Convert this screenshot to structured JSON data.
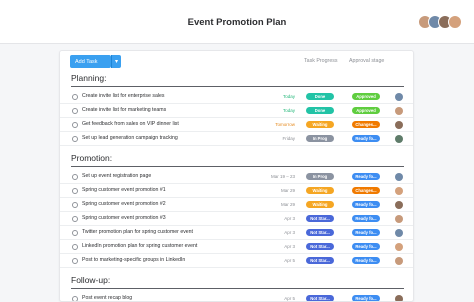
{
  "header": {
    "title": "Event Promotion Plan",
    "avatars": [
      "#c79a7b",
      "#6f89a8",
      "#8a6d5a",
      "#d4a17c"
    ]
  },
  "toolbar": {
    "add_task_label": "Add Task",
    "caret_icon": "chevron-down-icon",
    "col_progress": "Task Progress",
    "col_approval": "Approval stage"
  },
  "colors": {
    "accent": "#3aa0f0",
    "done": "#22c3a6",
    "approved": "#5fcd3f",
    "waiting": "#f5a623",
    "changes": "#f07a00",
    "in_prog": "#8b93a1",
    "ready": "#3d8df2",
    "not_started": "#4a68d9"
  },
  "sections": [
    {
      "label": "Planning:",
      "tasks": [
        {
          "name": "Create invite list for enterprise sales",
          "due": "Today",
          "due_color": "green",
          "progress": "Done",
          "progress_color": "#22c3a6",
          "approval": "Approved",
          "approval_color": "#5fcd3f",
          "avatar": "#6f89a8"
        },
        {
          "name": "Create invite list for marketing teams",
          "due": "Today",
          "due_color": "green",
          "progress": "Done",
          "progress_color": "#22c3a6",
          "approval": "Approved",
          "approval_color": "#5fcd3f",
          "avatar": "#c79a7b"
        },
        {
          "name": "Get feedback from sales on VIP dinner list",
          "due": "Tomorrow",
          "due_color": "orange",
          "progress": "Waiting",
          "progress_color": "#f5a623",
          "approval": "Changes...",
          "approval_color": "#f07a00",
          "avatar": "#8a6d5a"
        },
        {
          "name": "Set up lead generation campaign tracking",
          "due": "Friday",
          "due_color": "",
          "progress": "In Prog",
          "progress_color": "#8b93a1",
          "approval": "Ready fo...",
          "approval_color": "#3d8df2",
          "avatar": "#5f7c6a"
        }
      ]
    },
    {
      "label": "Promotion:",
      "tasks": [
        {
          "name": "Set up event registration page",
          "due": "Mar 19 – 23",
          "due_color": "",
          "progress": "In Prog",
          "progress_color": "#8b93a1",
          "approval": "Ready fo...",
          "approval_color": "#3d8df2",
          "avatar": "#6f89a8"
        },
        {
          "name": "Spring customer event promotion #1",
          "due": "Mar 29",
          "due_color": "",
          "progress": "Waiting",
          "progress_color": "#f5a623",
          "approval": "Changes...",
          "approval_color": "#f07a00",
          "avatar": "#d4a17c"
        },
        {
          "name": "Spring customer event promotion #2",
          "due": "Mar 29",
          "due_color": "",
          "progress": "Waiting",
          "progress_color": "#f5a623",
          "approval": "Ready fo...",
          "approval_color": "#3d8df2",
          "avatar": "#8a6d5a"
        },
        {
          "name": "Spring customer event promotion #3",
          "due": "Apr 3",
          "due_color": "",
          "progress": "Not Star...",
          "progress_color": "#4a68d9",
          "approval": "Ready fo...",
          "approval_color": "#3d8df2",
          "avatar": "#c79a7b"
        },
        {
          "name": "Twitter promotion plan for spring customer event",
          "due": "Apr 3",
          "due_color": "",
          "progress": "Not Star...",
          "progress_color": "#4a68d9",
          "approval": "Ready fo...",
          "approval_color": "#3d8df2",
          "avatar": "#6f89a8"
        },
        {
          "name": "LinkedIn promotion plan for spring customer event",
          "due": "Apr 3",
          "due_color": "",
          "progress": "Not Star...",
          "progress_color": "#4a68d9",
          "approval": "Ready fo...",
          "approval_color": "#3d8df2",
          "avatar": "#d4a17c"
        },
        {
          "name": "Post to marketing-specific groups in LinkedIn",
          "due": "Apr 5",
          "due_color": "",
          "progress": "Not Star...",
          "progress_color": "#4a68d9",
          "approval": "Ready fo...",
          "approval_color": "#3d8df2",
          "avatar": "#c79a7b"
        }
      ]
    },
    {
      "label": "Follow-up:",
      "tasks": [
        {
          "name": "Post event recap blog",
          "due": "Apr 5",
          "due_color": "",
          "progress": "Not Star...",
          "progress_color": "#4a68d9",
          "approval": "Ready fo...",
          "approval_color": "#3d8df2",
          "avatar": "#8a6d5a"
        }
      ]
    }
  ]
}
